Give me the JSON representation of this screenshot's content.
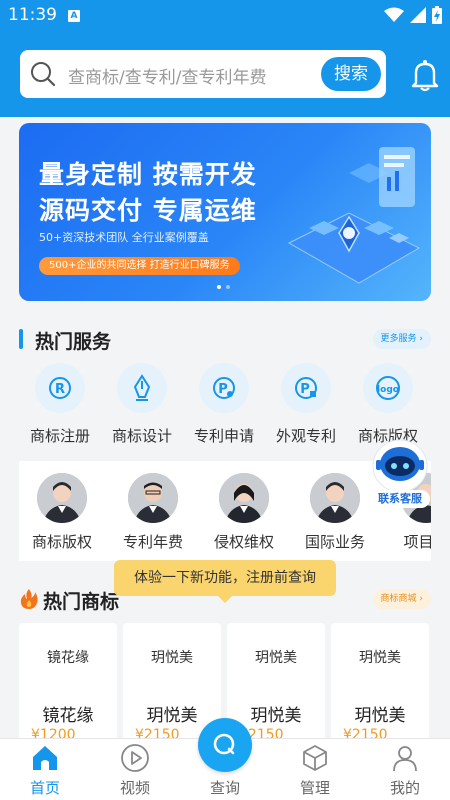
{
  "status_bar": {
    "time": "11:39",
    "notification_badge": "A"
  },
  "search": {
    "placeholder": "查商标/查专利/查专利年费",
    "button_label": "搜索"
  },
  "banner": {
    "headline_1": "量身定制 按需开发",
    "headline_2": "源码交付 专属运维",
    "subline": "50+资深技术团队  全行业案例覆盖",
    "pill": "500+企业的共同选择 打造行业口碑服务"
  },
  "hot_services": {
    "title": "热门服务",
    "more_label": "更多服务",
    "items": [
      {
        "label": "商标注册",
        "icon": "trademark-r-icon"
      },
      {
        "label": "商标设计",
        "icon": "pen-nib-icon"
      },
      {
        "label": "专利申请",
        "icon": "patent-p-icon"
      },
      {
        "label": "外观专利",
        "icon": "design-patent-icon"
      },
      {
        "label": "商标版权",
        "icon": "logo-copyright-icon"
      }
    ]
  },
  "experts": [
    {
      "label": "商标版权"
    },
    {
      "label": "专利年费"
    },
    {
      "label": "侵权维权"
    },
    {
      "label": "国际业务"
    },
    {
      "label": "项目设"
    }
  ],
  "customer_service": {
    "label": "联系客服"
  },
  "hot_trademarks": {
    "title": "热门商标",
    "more_label": "商标商城",
    "items": [
      {
        "logo_text": "镜花缘",
        "name": "镜花缘",
        "price": "¥1200"
      },
      {
        "logo_text": "玥悦美",
        "name": "玥悦美",
        "price": "¥2150"
      },
      {
        "logo_text": "玥悦美",
        "name": "玥悦美",
        "price": "¥2150"
      },
      {
        "logo_text": "玥悦美",
        "name": "玥悦美",
        "price": "¥2150"
      }
    ]
  },
  "tooltip": {
    "text": "体验一下新功能，注册前查询"
  },
  "bottom_nav": {
    "items": [
      {
        "label": "首页",
        "active": true
      },
      {
        "label": "视频"
      },
      {
        "label": "查询"
      },
      {
        "label": "管理"
      },
      {
        "label": "我的"
      }
    ]
  },
  "colors": {
    "primary": "#1596ea",
    "price": "#f39a1e",
    "tooltip": "#fad46d",
    "pill_orange": "#ff7a1a"
  }
}
